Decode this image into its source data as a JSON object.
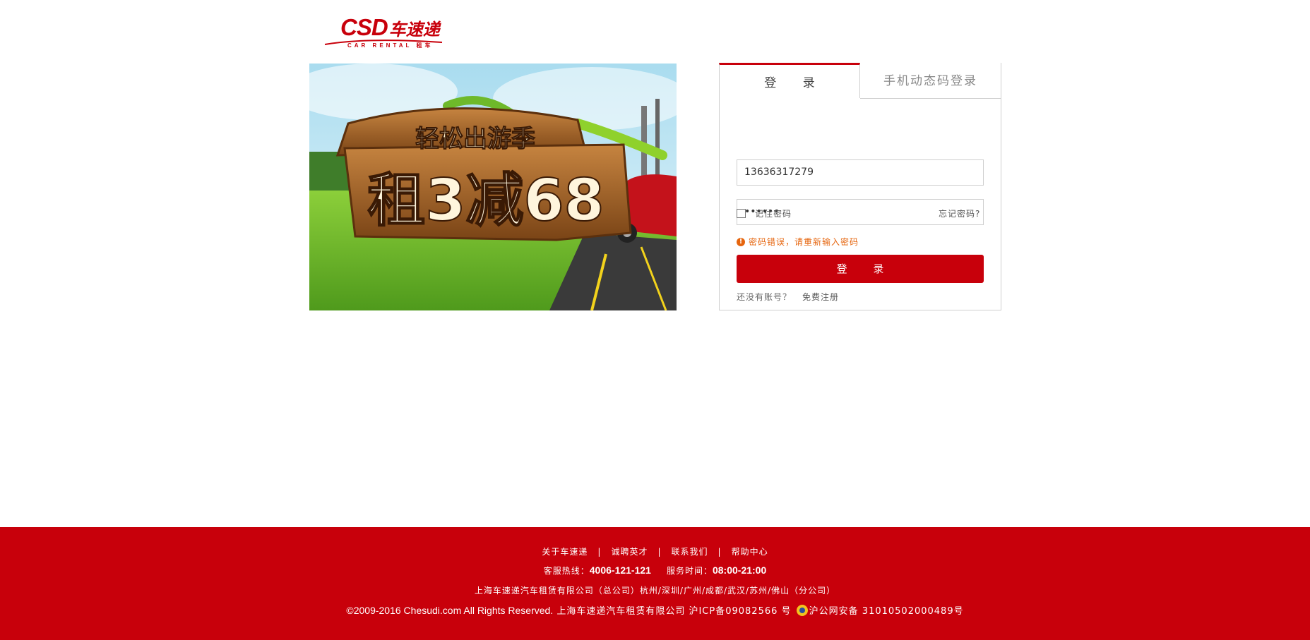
{
  "logo": {
    "mark": "CSD",
    "cn": "车速递",
    "sub": "CAR RENTAL 租车"
  },
  "banner": {
    "headline": "轻松出游季",
    "offer": "租3减68"
  },
  "tabs": [
    {
      "label": "登 录",
      "active": true
    },
    {
      "label": "手机动态码登录",
      "active": false
    }
  ],
  "form": {
    "username": "13636317279",
    "password": "••••••",
    "remember_label": "记住密码",
    "remember_checked": false,
    "forgot_label": "忘记密码?",
    "error": "密码错误，请重新输入密码",
    "login_button": "登 录",
    "no_account": "还没有账号？",
    "register": "免费注册"
  },
  "footer": {
    "links": [
      "关于车速递",
      "诚聘英才",
      "联系我们",
      "帮助中心"
    ],
    "separator": "|",
    "hotline_label": "客服热线：",
    "hotline": "4006-121-121",
    "hours_label": "服务时间：",
    "hours": "08:00-21:00",
    "company": "上海车速递汽车租赁有限公司（总公司）杭州/深圳/广州/成都/武汉/苏州/佛山（分公司）",
    "copyright_en": "©2009-2016 Chesudi.com All Rights Reserved.",
    "copyright_cn": "上海车速递汽车租赁有限公司 沪ICP备09082566 号",
    "police_record": "沪公网安备 31010502000489号"
  },
  "colors": {
    "brand_red": "#c8000b",
    "error_orange": "#e6650e"
  }
}
